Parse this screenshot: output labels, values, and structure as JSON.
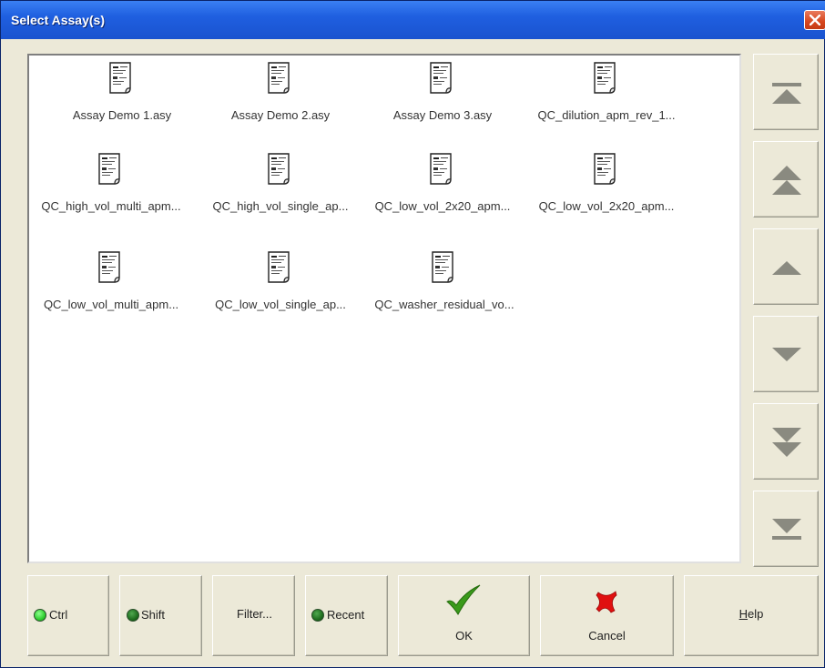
{
  "window": {
    "title": "Select Assay(s)",
    "close_icon": "close-icon"
  },
  "files": [
    {
      "name": "Assay Demo 1.asy",
      "icon": "document-icon"
    },
    {
      "name": "Assay Demo 2.asy",
      "icon": "document-icon"
    },
    {
      "name": "Assay Demo 3.asy",
      "icon": "document-icon"
    },
    {
      "name": "QC_dilution_apm_rev_1...",
      "icon": "document-icon"
    },
    {
      "name": "QC_high_vol_multi_apm...",
      "icon": "document-icon"
    },
    {
      "name": "QC_high_vol_single_ap...",
      "icon": "document-icon"
    },
    {
      "name": "QC_low_vol_2x20_apm...",
      "icon": "document-icon"
    },
    {
      "name": "QC_low_vol_2x20_apm...",
      "icon": "document-icon"
    },
    {
      "name": "QC_low_vol_multi_apm...",
      "icon": "document-icon"
    },
    {
      "name": "QC_low_vol_single_ap...",
      "icon": "document-icon"
    },
    {
      "name": "QC_washer_residual_vo...",
      "icon": "document-icon"
    }
  ],
  "nav": {
    "icons": [
      "scroll-top-icon",
      "page-up-icon",
      "line-up-icon",
      "line-down-icon",
      "page-down-icon",
      "scroll-bottom-icon"
    ]
  },
  "buttons": {
    "ctrl": {
      "label": "Ctrl",
      "indicator": "on"
    },
    "shift": {
      "label": "Shift",
      "indicator": "off"
    },
    "filter": {
      "label": "Filter..."
    },
    "recent": {
      "label": "Recent",
      "indicator": "off"
    },
    "ok": {
      "label": "OK",
      "icon": "checkmark-icon"
    },
    "cancel": {
      "label": "Cancel",
      "icon": "x-mark-icon"
    },
    "help": {
      "hotkey": "H",
      "label_rest": "elp"
    }
  },
  "colors": {
    "titlebar": "#1f5fe0",
    "face": "#ece9d8",
    "led_on": "#2fce2f",
    "led_off": "#1f6e1f",
    "ok_green": "#3a9a1a",
    "cancel_red": "#e01010"
  }
}
